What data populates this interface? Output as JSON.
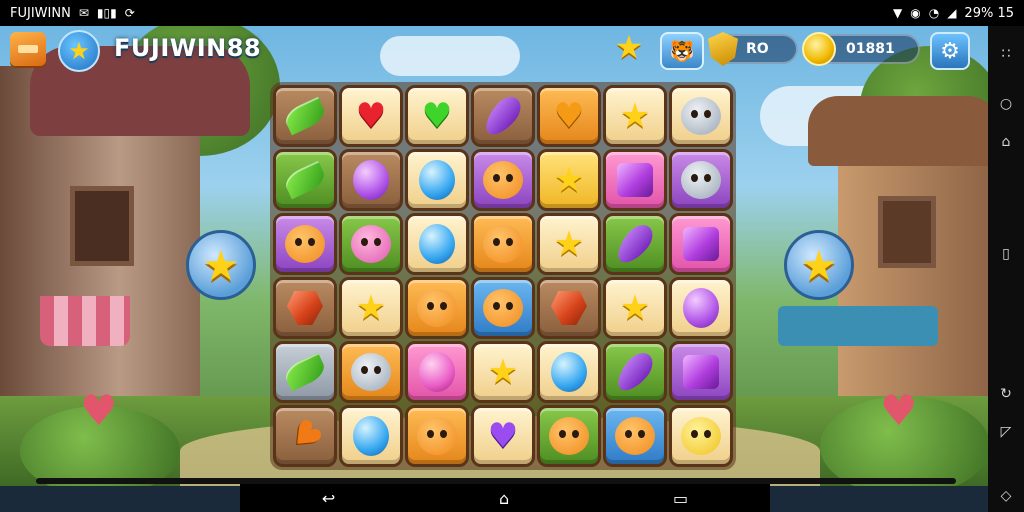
{
  "status_bar": {
    "left_text": "FUJIWINN",
    "left_icons": [
      "message-icon",
      "signal-bars-icon",
      "sync-icon"
    ],
    "right_icons": [
      "location-icon",
      "alarm-icon",
      "wifi-icon",
      "signal-icon"
    ],
    "right_text": "29% 15"
  },
  "hud": {
    "title": "FUJIWIN88",
    "shield_value": "RO",
    "coin_value": "01881",
    "colors": {
      "accent": "#2a74bb",
      "gold": "#ffd21a"
    }
  },
  "board": {
    "rows": [
      [
        "leaf|t-brown",
        "heart-red|t-cream",
        "heart-green|t-cream",
        "eggplant|t-brown",
        "heart-orange|t-orange",
        "star|t-cream",
        "face-grey|t-cream"
      ],
      [
        "leaf|t-green",
        "orb-purple|t-brown",
        "orb-blue|t-cream",
        "face-orange|t-purple",
        "star|t-yellow",
        "gem-purple|t-pink",
        "face-grey|t-purple"
      ],
      [
        "face-orange|t-purple",
        "face-pink|t-green",
        "orb-blue|t-cream",
        "face-orange|t-orange",
        "star|t-cream",
        "eggplant|t-green",
        "gem-purple|t-pink"
      ],
      [
        "gem-red|t-brown",
        "star|t-cream",
        "face-orange|t-orange",
        "face-orange|t-blue",
        "gem-red|t-brown",
        "star|t-cream",
        "orb-purple|t-cream"
      ],
      [
        "leaf|t-grey",
        "face-grey|t-orange",
        "orb-pink|t-pink",
        "star|t-cream",
        "orb-blue|t-cream",
        "eggplant|t-green",
        "gem-purple|t-purple"
      ],
      [
        "carrot|t-brown",
        "orb-blue|t-cream",
        "face-orange|t-orange",
        "heart-purple|t-cream",
        "face-orange|t-green",
        "face-orange|t-blue",
        "face-yellow|t-cream"
      ]
    ]
  },
  "side_bubbles": {
    "left": "star-icon",
    "right": "star-icon"
  },
  "nav": {
    "back": "↩",
    "home": "⌂",
    "recents": "▭"
  }
}
